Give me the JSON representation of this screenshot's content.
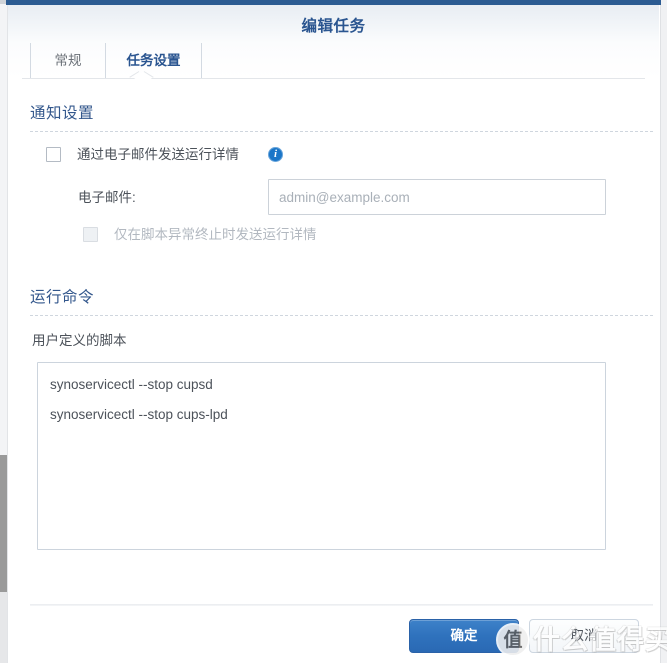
{
  "window": {
    "title": "编辑任务",
    "accent_color": "#2b5b92"
  },
  "tabs": [
    {
      "label": "常规",
      "active": false
    },
    {
      "label": "任务设置",
      "active": true
    }
  ],
  "sections": {
    "notification": {
      "title": "通知设置",
      "send_email_checkbox": {
        "label": "通过电子邮件发送运行详情",
        "checked": false,
        "info_glyph": "i"
      },
      "email_field": {
        "label": "电子邮件:",
        "value": "",
        "placeholder": "admin@example.com"
      },
      "abnormal_only_checkbox": {
        "label": "仅在脚本异常终止时发送运行详情",
        "checked": false,
        "disabled": true
      }
    },
    "run_command": {
      "title": "运行命令",
      "script_label": "用户定义的脚本",
      "script_value": "synoservicectl --stop cupsd\nsynoservicectl --stop cups-lpd"
    }
  },
  "footer": {
    "ok_label": "确定",
    "cancel_label": "取消"
  },
  "watermark": {
    "logo_char": "值",
    "text": "什么值得买"
  }
}
